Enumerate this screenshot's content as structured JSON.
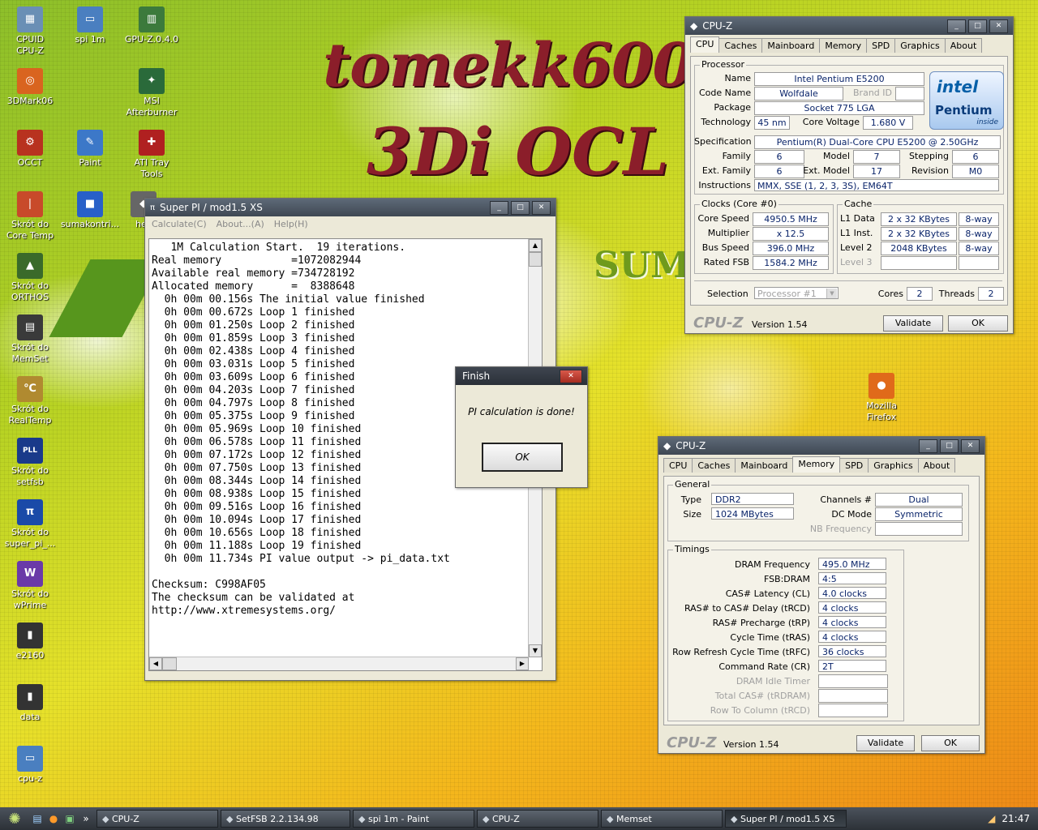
{
  "desktop": {
    "graffiti_line1": "tomekk600",
    "graffiti_line2": "3Di OCL",
    "background_text": "SUMM",
    "icons": [
      {
        "label": "CPUID\nCPU-Z",
        "icon": "chip-icon"
      },
      {
        "label": "spi 1m",
        "icon": "image-file-icon"
      },
      {
        "label": "GPU-Z.0.4.0",
        "icon": "gpu-card-icon"
      },
      {
        "label": "3DMark06",
        "icon": "3dmark-icon"
      },
      {
        "label": "MSI\nAfterburner",
        "icon": "afterburner-icon"
      },
      {
        "label": "OCCT",
        "icon": "occt-icon"
      },
      {
        "label": "Paint",
        "icon": "paint-icon"
      },
      {
        "label": "ATI Tray\nTools",
        "icon": "ati-tray-icon"
      },
      {
        "label": "Skrót do\nCore Temp",
        "icon": "thermometer-icon"
      },
      {
        "label": "sumakontri...",
        "icon": "colors-icon"
      },
      {
        "label": "hex",
        "icon": "hex-icon"
      },
      {
        "label": "Skrót do\nORTHOS",
        "icon": "orthos-icon"
      },
      {
        "label": "Skrót do\nMemSet",
        "icon": "memory-module-icon"
      },
      {
        "label": "Skrót do\nRealTemp",
        "icon": "realtemp-icon"
      },
      {
        "label": "Skrót do\nsetfsb",
        "icon": "pll-icon"
      },
      {
        "label": "Skrót do\nsuper_pi_...",
        "icon": "superpi-icon"
      },
      {
        "label": "Skrót do\nwPrime",
        "icon": "wprime-icon"
      },
      {
        "label": "e2160",
        "icon": "folder-icon"
      },
      {
        "label": "data",
        "icon": "folder-icon"
      },
      {
        "label": "cpu-z",
        "icon": "image-file-icon"
      },
      {
        "label": "Mozilla\nFirefox",
        "icon": "firefox-icon"
      }
    ]
  },
  "cpuz_cpu": {
    "title": "CPU-Z",
    "tabs": [
      "CPU",
      "Caches",
      "Mainboard",
      "Memory",
      "SPD",
      "Graphics",
      "About"
    ],
    "active_tab": "CPU",
    "processor_group": "Processor",
    "labels": {
      "name": "Name",
      "code_name": "Code Name",
      "brand_id": "Brand ID",
      "package": "Package",
      "technology": "Technology",
      "core_voltage": "Core Voltage",
      "specification": "Specification",
      "family": "Family",
      "model": "Model",
      "stepping": "Stepping",
      "ext_family": "Ext. Family",
      "ext_model": "Ext. Model",
      "revision": "Revision",
      "instructions": "Instructions",
      "clocks_group": "Clocks (Core #0)",
      "core_speed": "Core Speed",
      "multiplier": "Multiplier",
      "bus_speed": "Bus Speed",
      "rated_fsb": "Rated FSB",
      "cache_group": "Cache",
      "l1_data": "L1 Data",
      "l1_inst": "L1 Inst.",
      "level2": "Level 2",
      "level3": "Level 3",
      "selection": "Selection",
      "cores": "Cores",
      "threads": "Threads"
    },
    "values": {
      "name": "Intel Pentium E5200",
      "code_name": "Wolfdale",
      "brand_id": "",
      "package": "Socket 775 LGA",
      "technology": "45 nm",
      "core_voltage": "1.680 V",
      "specification": "Pentium(R) Dual-Core  CPU    E5200  @ 2.50GHz",
      "family": "6",
      "model": "7",
      "stepping": "6",
      "ext_family": "6",
      "ext_model": "17",
      "revision": "M0",
      "instructions": "MMX, SSE (1, 2, 3, 3S), EM64T",
      "core_speed": "4950.5 MHz",
      "multiplier": "x 12.5",
      "bus_speed": "396.0 MHz",
      "rated_fsb": "1584.2 MHz",
      "l1_data": "2 x 32 KBytes",
      "l1_data_way": "8-way",
      "l1_inst": "2 x 32 KBytes",
      "l1_inst_way": "8-way",
      "level2": "2048 KBytes",
      "level2_way": "8-way",
      "selection": "Processor #1",
      "cores": "2",
      "threads": "2"
    },
    "logo_brand": "intel",
    "logo_product": "Pentium",
    "logo_inside": "inside",
    "footer_brand": "CPU-Z",
    "version": "Version 1.54",
    "validate": "Validate",
    "ok": "OK"
  },
  "cpuz_mem": {
    "title": "CPU-Z",
    "tabs": [
      "CPU",
      "Caches",
      "Mainboard",
      "Memory",
      "SPD",
      "Graphics",
      "About"
    ],
    "active_tab": "Memory",
    "general_group": "General",
    "timings_group": "Timings",
    "labels": {
      "type": "Type",
      "size": "Size",
      "channels": "Channels #",
      "dc_mode": "DC Mode",
      "nb_freq": "NB Frequency",
      "dram_freq": "DRAM Frequency",
      "fsb_dram": "FSB:DRAM",
      "cas": "CAS# Latency (CL)",
      "trcd": "RAS# to CAS# Delay (tRCD)",
      "trp": "RAS# Precharge (tRP)",
      "tras": "Cycle Time (tRAS)",
      "trfc": "Row Refresh Cycle Time (tRFC)",
      "cr": "Command Rate (CR)",
      "idle": "DRAM Idle Timer",
      "total_cas": "Total CAS# (tRDRAM)",
      "row_col": "Row To Column (tRCD)"
    },
    "values": {
      "type": "DDR2",
      "size": "1024 MBytes",
      "channels": "Dual",
      "dc_mode": "Symmetric",
      "dram_freq": "495.0 MHz",
      "fsb_dram": "4:5",
      "cas": "4.0 clocks",
      "trcd": "4 clocks",
      "trp": "4 clocks",
      "tras": "4 clocks",
      "trfc": "36 clocks",
      "cr": "2T"
    },
    "footer_brand": "CPU-Z",
    "version": "Version 1.54",
    "validate": "Validate",
    "ok": "OK"
  },
  "superpi": {
    "title": "Super PI / mod1.5 XS",
    "menu": [
      "Calculate(C)",
      "About...(A)",
      "Help(H)"
    ],
    "lines": [
      "   1M Calculation Start.  19 iterations.",
      "Real memory           =1072082944",
      "Available real memory =734728192",
      "Allocated memory      =  8388648",
      "  0h 00m 00.156s The initial value finished",
      "  0h 00m 00.672s Loop 1 finished",
      "  0h 00m 01.250s Loop 2 finished",
      "  0h 00m 01.859s Loop 3 finished",
      "  0h 00m 02.438s Loop 4 finished",
      "  0h 00m 03.031s Loop 5 finished",
      "  0h 00m 03.609s Loop 6 finished",
      "  0h 00m 04.203s Loop 7 finished",
      "  0h 00m 04.797s Loop 8 finished",
      "  0h 00m 05.375s Loop 9 finished",
      "  0h 00m 05.969s Loop 10 finished",
      "  0h 00m 06.578s Loop 11 finished",
      "  0h 00m 07.172s Loop 12 finished",
      "  0h 00m 07.750s Loop 13 finished",
      "  0h 00m 08.344s Loop 14 finished",
      "  0h 00m 08.938s Loop 15 finished",
      "  0h 00m 09.516s Loop 16 finished",
      "  0h 00m 10.094s Loop 17 finished",
      "  0h 00m 10.656s Loop 18 finished",
      "  0h 00m 11.188s Loop 19 finished",
      "  0h 00m 11.734s PI value output -> pi_data.txt",
      "",
      "Checksum: C998AF05",
      "The checksum can be validated at",
      "http://www.xtremesystems.org/"
    ]
  },
  "finish_dialog": {
    "title": "Finish",
    "message": "PI calculation is done!",
    "ok": "OK"
  },
  "taskbar": {
    "tasks": [
      {
        "label": "CPU-Z",
        "icon": "cpuz-icon",
        "active": false
      },
      {
        "label": "SetFSB 2.2.134.98",
        "icon": "pll-icon",
        "active": false
      },
      {
        "label": "spi 1m - Paint",
        "icon": "paint-icon",
        "active": false
      },
      {
        "label": "CPU-Z",
        "icon": "cpuz-icon",
        "active": false
      },
      {
        "label": "Memset",
        "icon": "memory-module-icon",
        "active": false
      },
      {
        "label": "Super PI / mod1.5 XS",
        "icon": "superpi-icon",
        "active": true
      }
    ],
    "clock": "21:47"
  }
}
